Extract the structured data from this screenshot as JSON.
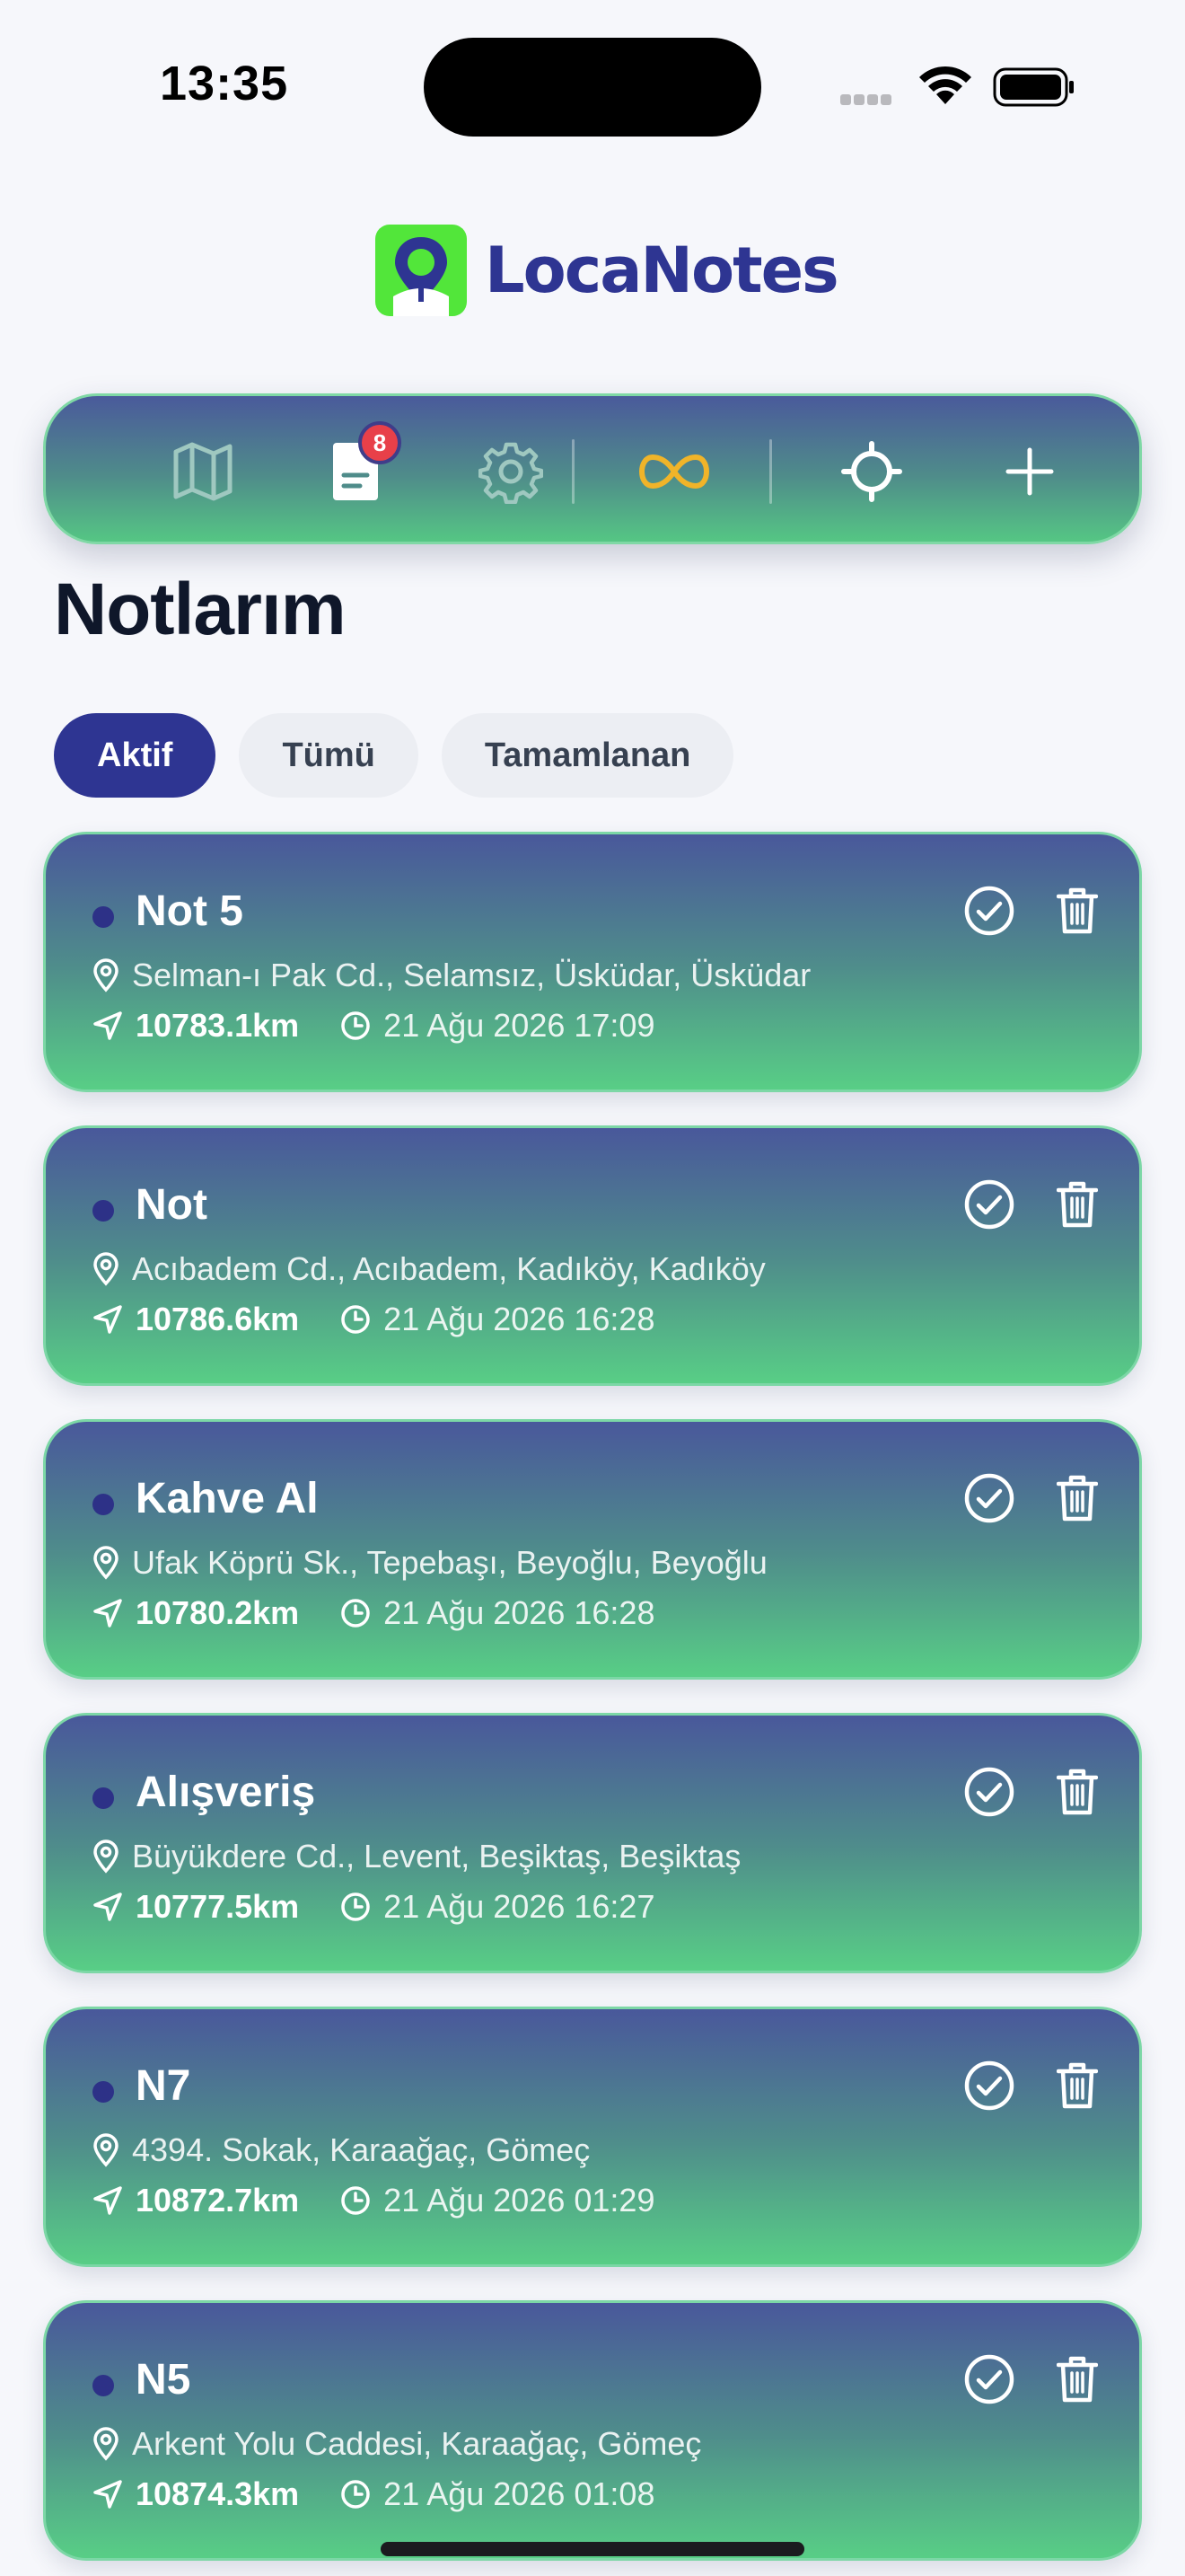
{
  "status_bar": {
    "time": "13:35"
  },
  "app": {
    "name": "LocaNotes"
  },
  "toolbar": {
    "notes_badge": "8",
    "buttons": [
      "map-icon",
      "notes-icon",
      "gear-icon",
      "infinity-icon",
      "crosshair-icon",
      "plus-icon"
    ],
    "colors": {
      "infinity": "#f0b429",
      "badge": "#e84049"
    }
  },
  "page": {
    "title": "Notlarım"
  },
  "filters": [
    {
      "label": "Aktif",
      "active": true
    },
    {
      "label": "Tümü",
      "active": false
    },
    {
      "label": "Tamamlanan",
      "active": false
    }
  ],
  "notes": [
    {
      "title": "Not 5",
      "address": "Selman-ı Pak Cd., Selamsız, Üsküdar, Üsküdar",
      "distance": "10783.1km",
      "date": "21 Ağu 2026 17:09"
    },
    {
      "title": "Not",
      "address": "Acıbadem Cd., Acıbadem, Kadıköy, Kadıköy",
      "distance": "10786.6km",
      "date": "21 Ağu 2026 16:28"
    },
    {
      "title": "Kahve Al",
      "address": "Ufak Köprü Sk., Tepebaşı, Beyoğlu, Beyoğlu",
      "distance": "10780.2km",
      "date": "21 Ağu 2026 16:28"
    },
    {
      "title": "Alışveriş",
      "address": "Büyükdere Cd., Levent, Beşiktaş, Beşiktaş",
      "distance": "10777.5km",
      "date": "21 Ağu 2026 16:27"
    },
    {
      "title": "N7",
      "address": "4394. Sokak, Karaağaç, Gömeç",
      "distance": "10872.7km",
      "date": "21 Ağu 2026 01:29"
    },
    {
      "title": "N5",
      "address": "Arkent Yolu Caddesi, Karaağaç, Gömeç",
      "distance": "10874.3km",
      "date": "21 Ağu 2026 01:08"
    }
  ],
  "colors": {
    "brand": "#2e3592",
    "logo_bg": "#52e63a",
    "card_top": "#49589b",
    "card_bottom": "#58ce86"
  }
}
